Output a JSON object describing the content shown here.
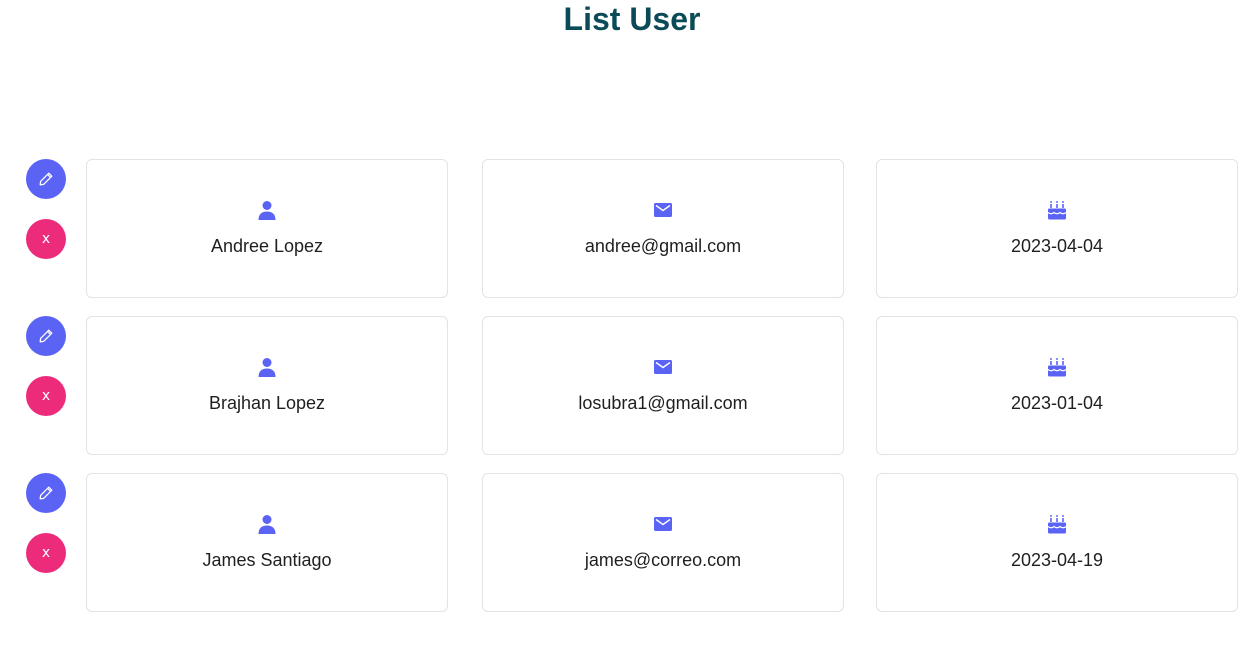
{
  "page": {
    "title": "List User"
  },
  "colors": {
    "accent": "#5b63f5",
    "danger": "#ec2b7a",
    "title": "#0b4a57"
  },
  "actions": {
    "edit_icon": "pencil-icon",
    "delete_icon": "close-icon",
    "delete_glyph": "x"
  },
  "users": [
    {
      "name": "Andree Lopez",
      "email": "andree@gmail.com",
      "date": "2023-04-04"
    },
    {
      "name": "Brajhan Lopez",
      "email": "losubra1@gmail.com",
      "date": "2023-01-04"
    },
    {
      "name": "James Santiago",
      "email": "james@correo.com",
      "date": "2023-04-19"
    }
  ]
}
